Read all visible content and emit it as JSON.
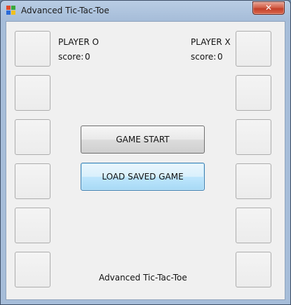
{
  "window": {
    "title": "Advanced Tic-Tac-Toe",
    "close_label": "✕"
  },
  "players": {
    "o": {
      "name": "PLAYER O",
      "score_label": "score:",
      "score": "0"
    },
    "x": {
      "name": "PLAYER X",
      "score_label": "score:",
      "score": "0"
    }
  },
  "buttons": {
    "start": "GAME START",
    "load": "LOAD SAVED GAME"
  },
  "footer": "Advanced Tic-Tac-Toe",
  "colors": {
    "client_bg": "#f0f0f0",
    "load_button_accent": "#3c7fb1",
    "close_button": "#c3402a"
  }
}
